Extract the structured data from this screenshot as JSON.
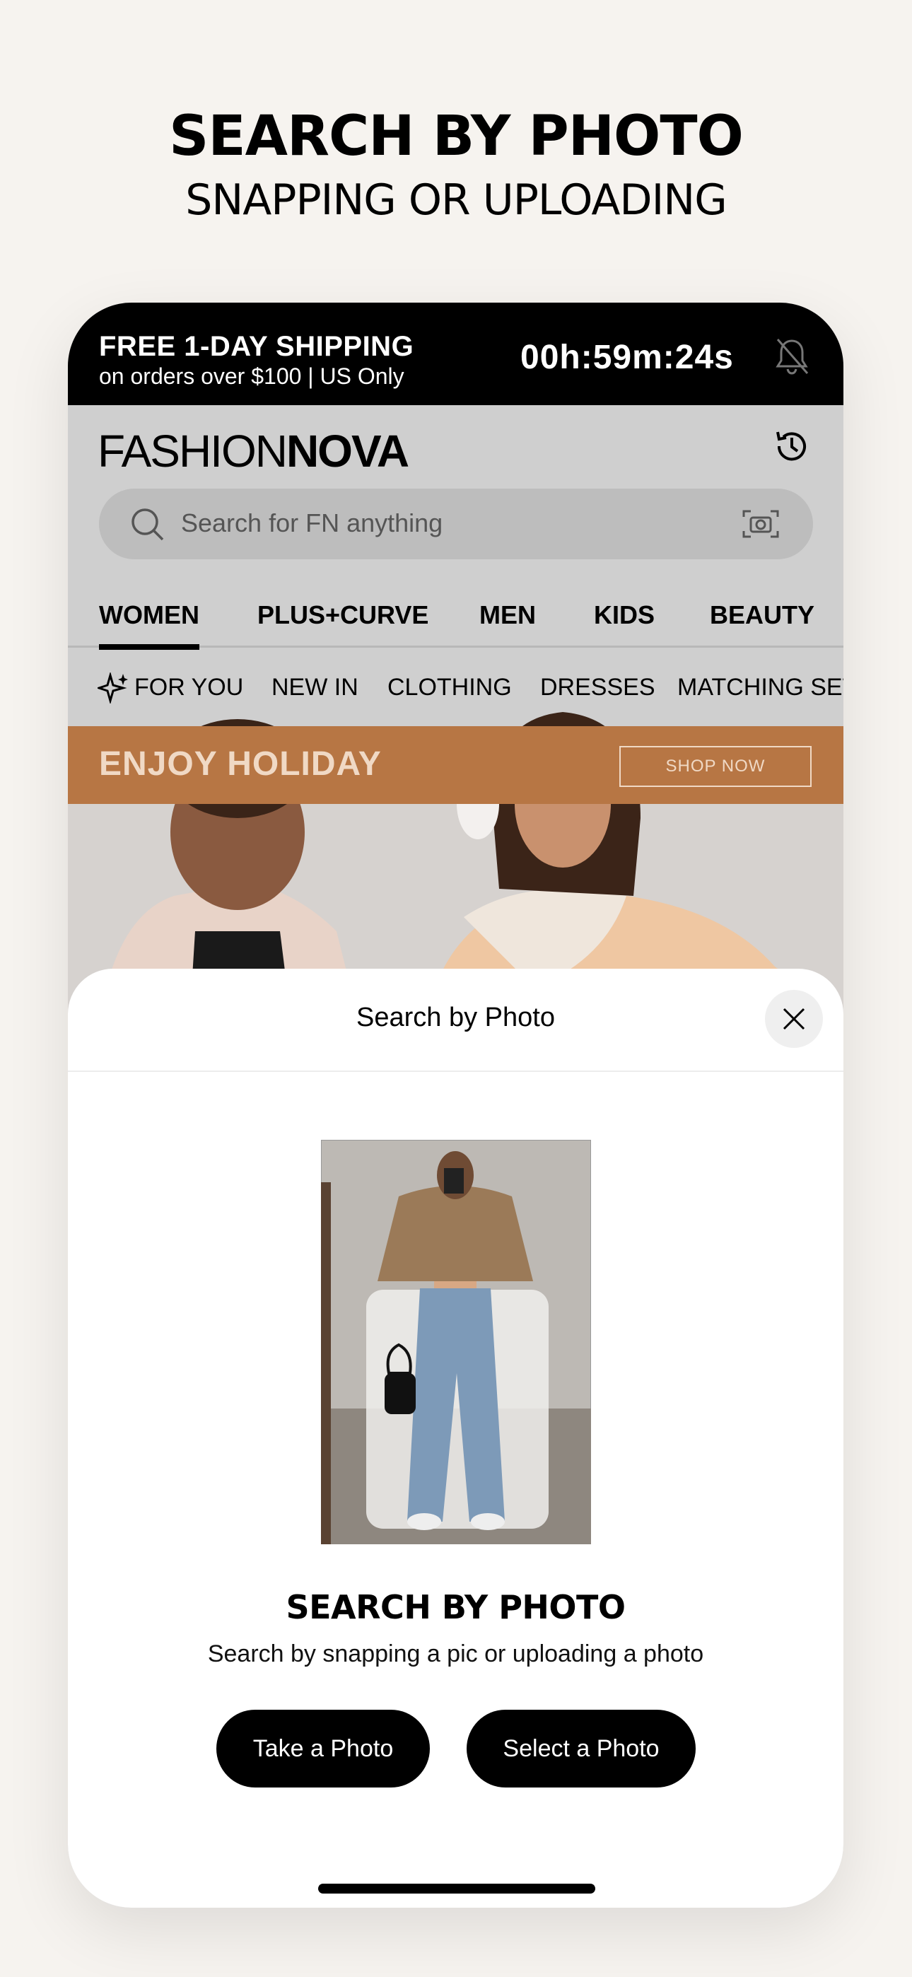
{
  "hero": {
    "title": "SEARCH BY PHOTO",
    "subtitle": "SNAPPING OR UPLOADING"
  },
  "promo": {
    "line1": "FREE 1-DAY SHIPPING",
    "line2": "on orders over $100 | US Only",
    "timer": "00h:59m:24s"
  },
  "header": {
    "logo_thin": "FASHION",
    "logo_bold": "NOVA",
    "search_placeholder": "Search for FN anything"
  },
  "tabs": [
    {
      "label": "WOMEN",
      "active": true
    },
    {
      "label": "PLUS+CURVE"
    },
    {
      "label": "MEN"
    },
    {
      "label": "KIDS"
    },
    {
      "label": "BEAUTY"
    }
  ],
  "subnav": [
    "FOR YOU",
    "NEW IN",
    "CLOTHING",
    "DRESSES",
    "MATCHING SETS"
  ],
  "banner": {
    "text": "ENJOY HOLIDAY",
    "button": "SHOP NOW"
  },
  "sheet": {
    "title": "Search by Photo",
    "heading": "SEARCH BY PHOTO",
    "description": "Search by snapping a pic or uploading a photo",
    "take_photo": "Take a Photo",
    "select_photo": "Select a Photo"
  },
  "colors": {
    "banner": "#b77644",
    "accent": "#000000",
    "background": "#f6f3ef"
  }
}
